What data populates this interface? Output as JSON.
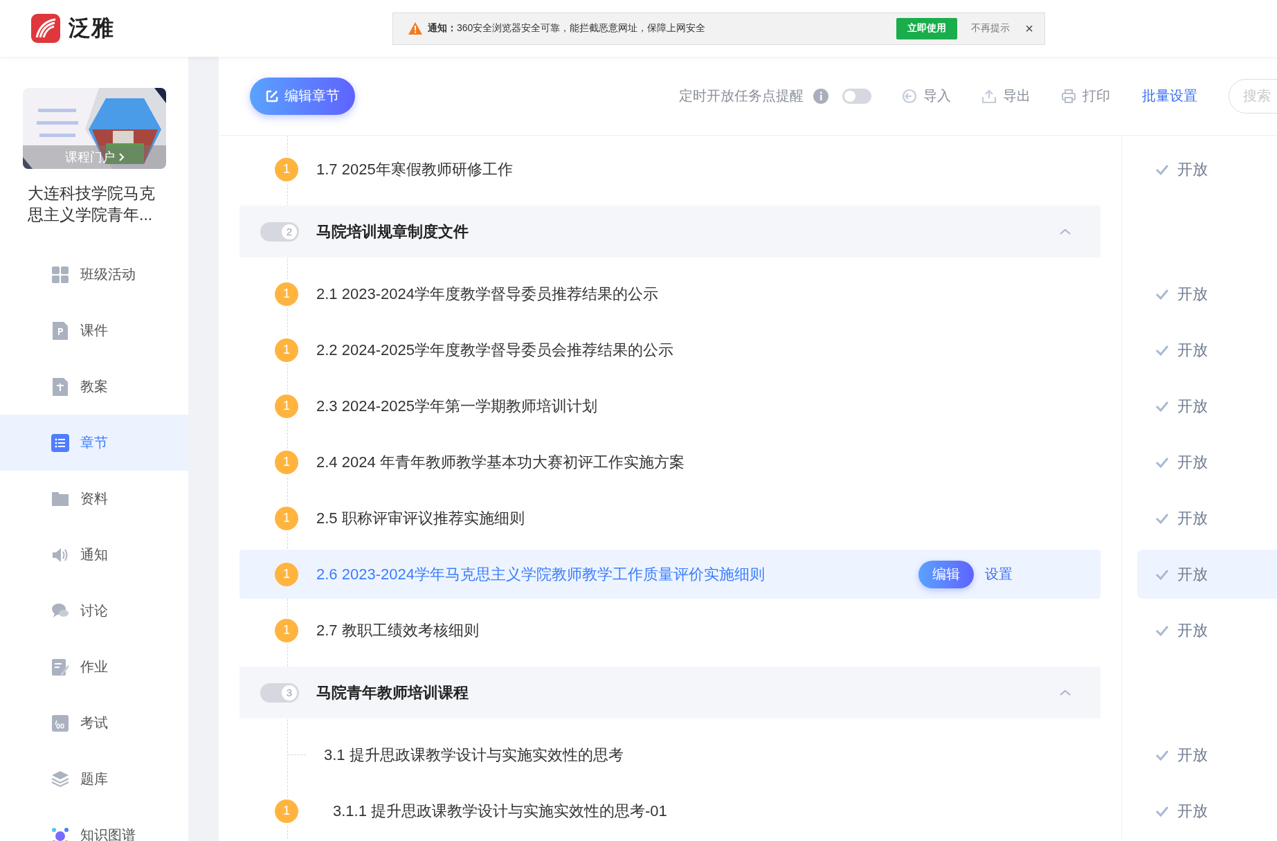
{
  "app": {
    "logo_text": "泛雅"
  },
  "notice": {
    "label": "通知：",
    "message": "360安全浏览器安全可靠，能拦截恶意网址，保障上网安全",
    "action": "立即使用",
    "dismiss": "不再提示",
    "close": "×"
  },
  "course": {
    "cover_link": "课程门户",
    "title": "大连科技学院马克思主义学院青年..."
  },
  "sidebar": {
    "items": [
      {
        "label": "班级活动",
        "selected": false
      },
      {
        "label": "课件",
        "selected": false
      },
      {
        "label": "教案",
        "selected": false
      },
      {
        "label": "章节",
        "selected": true
      },
      {
        "label": "资料",
        "selected": false
      },
      {
        "label": "通知",
        "selected": false
      },
      {
        "label": "讨论",
        "selected": false
      },
      {
        "label": "作业",
        "selected": false
      },
      {
        "label": "考试",
        "selected": false
      },
      {
        "label": "题库",
        "selected": false
      },
      {
        "label": "知识图谱",
        "selected": false
      }
    ]
  },
  "toolbar": {
    "edit_button": "编辑章节",
    "reminder_label": "定时开放任务点提醒",
    "reminder_on": false,
    "import": "导入",
    "export": "导出",
    "print": "打印",
    "batch": "批量设置",
    "search": {
      "placeholder": "搜索"
    }
  },
  "chapters": [
    {
      "kind": "item",
      "title": "1.7 2025年寒假教师研修工作",
      "badge": "1",
      "status": "开放",
      "selected": false
    },
    {
      "kind": "group",
      "number": "2",
      "title": "马院培训规章制度文件",
      "expanded": true,
      "children": [
        {
          "kind": "item",
          "title": "2.1 2023-2024学年度教学督导委员推荐结果的公示",
          "badge": "1",
          "status": "开放",
          "selected": false
        },
        {
          "kind": "item",
          "title": "2.2 2024-2025学年度教学督导委员会推荐结果的公示",
          "badge": "1",
          "status": "开放",
          "selected": false
        },
        {
          "kind": "item",
          "title": "2.3 2024-2025学年第一学期教师培训计划",
          "badge": "1",
          "status": "开放",
          "selected": false
        },
        {
          "kind": "item",
          "title": "2.4 2024 年青年教师教学基本功大赛初评工作实施方案",
          "badge": "1",
          "status": "开放",
          "selected": false
        },
        {
          "kind": "item",
          "title": "2.5 职称评审评议推荐实施细则",
          "badge": "1",
          "status": "开放",
          "selected": false
        },
        {
          "kind": "item",
          "title": "2.6 2023-2024学年马克思主义学院教师教学工作质量评价实施细则",
          "badge": "1",
          "status": "开放",
          "selected": true,
          "actions": [
            "编辑",
            "设置"
          ]
        },
        {
          "kind": "item",
          "title": "2.7 教职工绩效考核细则",
          "badge": "1",
          "status": "开放",
          "selected": false
        }
      ]
    },
    {
      "kind": "group",
      "number": "3",
      "title": "马院青年教师培训课程",
      "expanded": true,
      "children": [
        {
          "kind": "item",
          "title": "3.1 提升思政课教学设计与实施实效性的思考",
          "status": "开放",
          "selected": false,
          "children": [
            {
              "kind": "item",
              "title": "3.1.1 提升思政课教学设计与实施实效性的思考-01",
              "badge": "1",
              "status": "开放",
              "selected": false
            }
          ]
        }
      ]
    }
  ]
}
